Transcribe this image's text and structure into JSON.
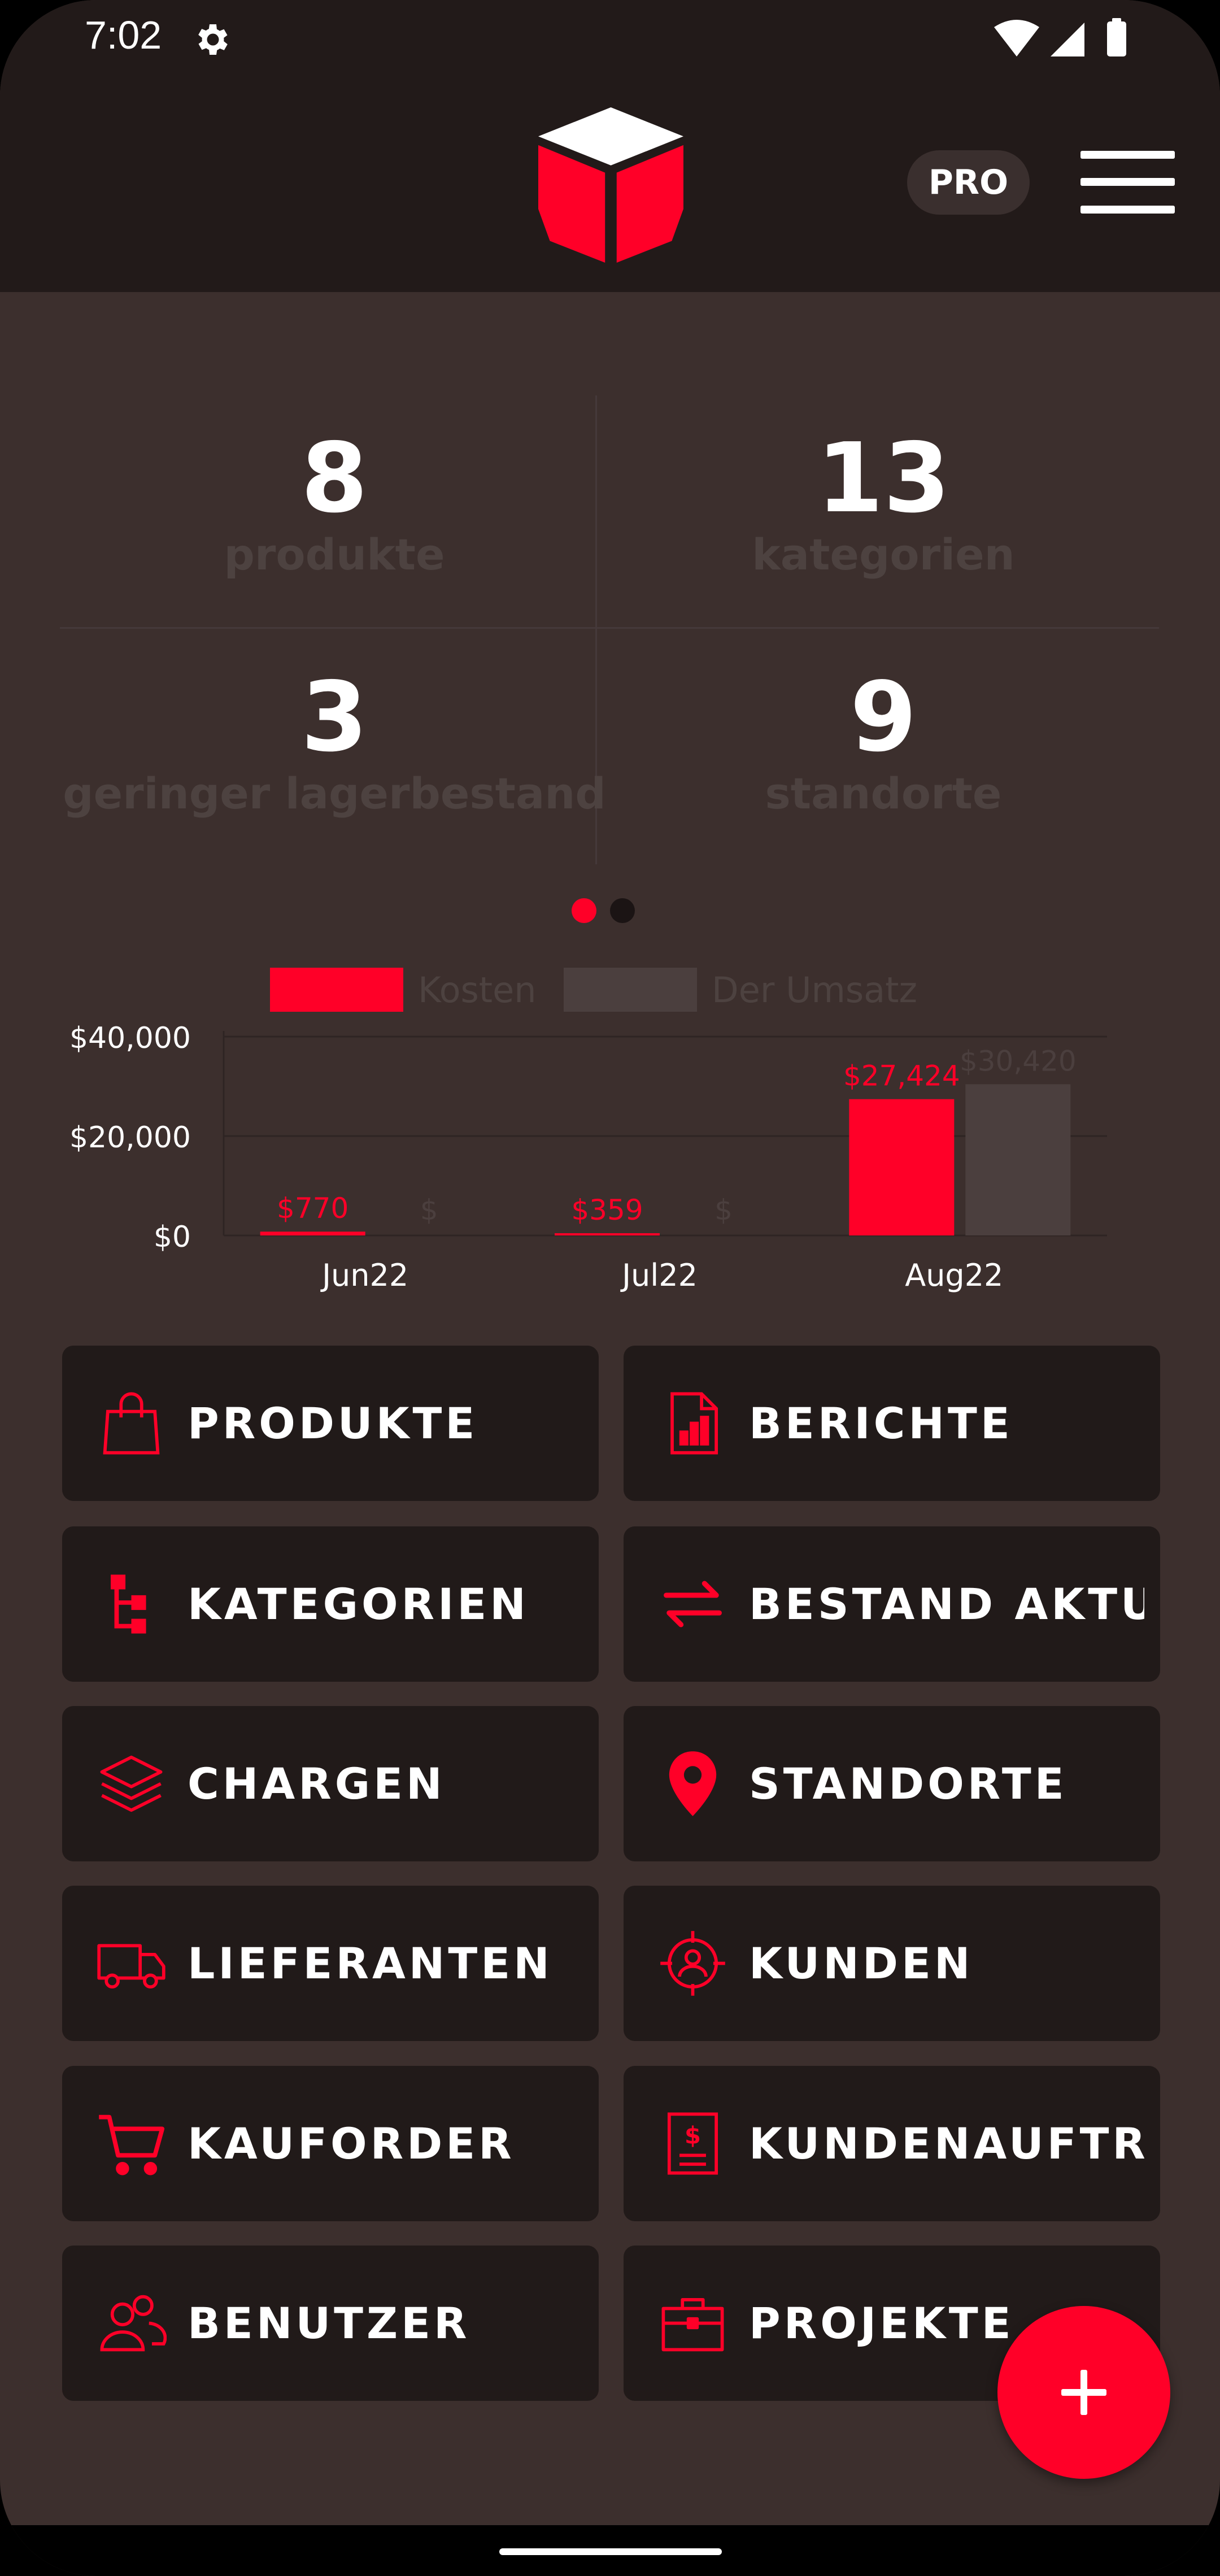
{
  "status_bar": {
    "time": "7:02"
  },
  "header": {
    "pro_label": "PRO"
  },
  "stats": [
    {
      "value": "8",
      "label": "produkte"
    },
    {
      "value": "13",
      "label": "kategorien"
    },
    {
      "value": "3",
      "label": "geringer lagerbestand"
    },
    {
      "value": "9",
      "label": "standorte"
    }
  ],
  "pager": {
    "page_count": 2,
    "active_page": 0
  },
  "chart_data": {
    "type": "bar",
    "categories": [
      "Jun22",
      "Jul22",
      "Aug22"
    ],
    "series": [
      {
        "name": "Kosten",
        "values": [
          770,
          359,
          27424
        ],
        "labels": [
          "$770",
          "$359",
          "$27,424"
        ],
        "color": "#ff0028"
      },
      {
        "name": "Der Umsatz",
        "values": [
          0,
          0,
          30420
        ],
        "labels": [
          "$",
          "$",
          "$30,420"
        ],
        "color": "#4b3f3e"
      }
    ],
    "y_ticks": [
      0,
      20000,
      40000
    ],
    "y_tick_labels": [
      "$0",
      "$20,000",
      "$40,000"
    ],
    "ylim": [
      0,
      40000
    ],
    "grid": true,
    "legend_position": "top-center"
  },
  "tiles": [
    {
      "label": "PRODUKTE",
      "icon": "shopping-bag-icon"
    },
    {
      "label": "BERICHTE",
      "icon": "report-icon"
    },
    {
      "label": "KATEGORIEN",
      "icon": "hierarchy-icon"
    },
    {
      "label": "BESTAND AKTUALISIEREN",
      "icon": "swap-arrows-icon"
    },
    {
      "label": "CHARGEN",
      "icon": "layers-icon"
    },
    {
      "label": "STANDORTE",
      "icon": "location-pin-icon"
    },
    {
      "label": "LIEFERANTEN",
      "icon": "truck-icon"
    },
    {
      "label": "KUNDEN",
      "icon": "customer-target-icon"
    },
    {
      "label": "KAUFORDER",
      "icon": "cart-icon"
    },
    {
      "label": "KUNDENAUFTRÄGE",
      "icon": "invoice-icon"
    },
    {
      "label": "BENUTZER",
      "icon": "users-icon"
    },
    {
      "label": "PROJEKTE",
      "icon": "briefcase-icon"
    }
  ],
  "colors": {
    "accent": "#ff0028",
    "background": "#3c2f2d",
    "tile": "#211a19",
    "header": "#221a19"
  }
}
